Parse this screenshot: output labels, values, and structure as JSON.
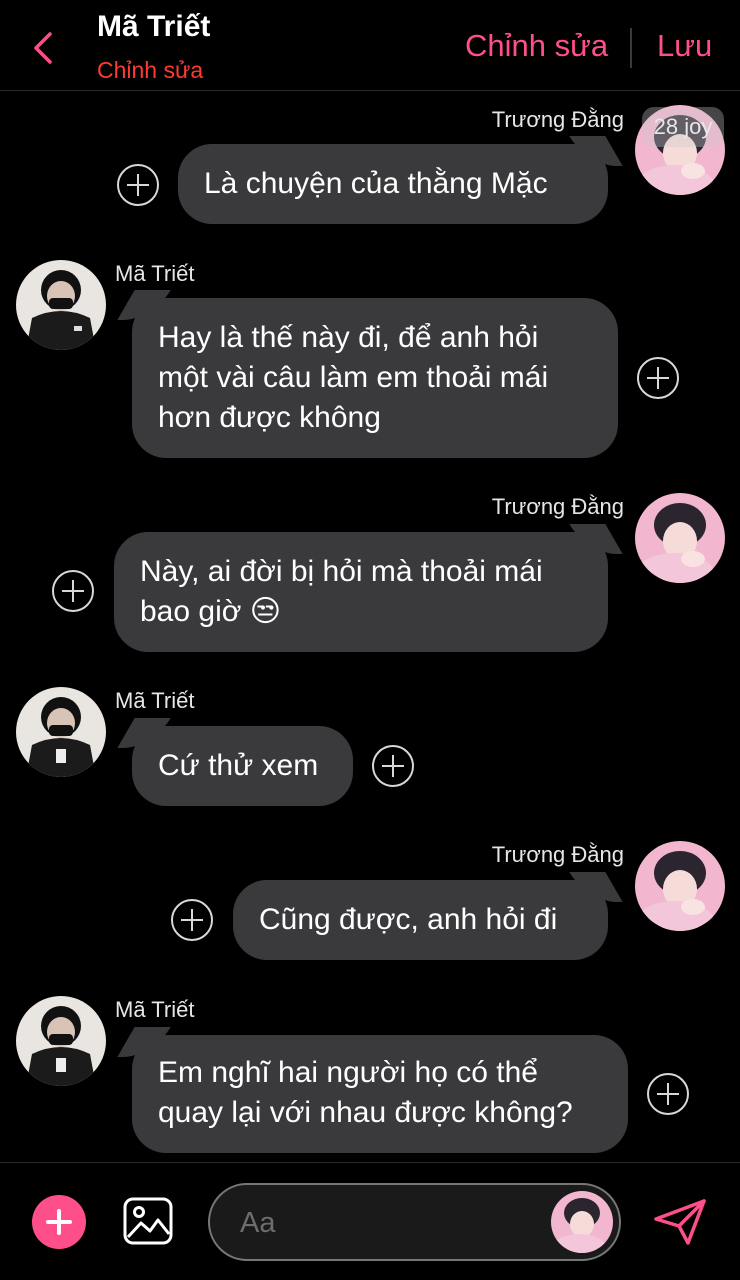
{
  "header": {
    "title": "Mã Triết",
    "subtitle": "Chỉnh sửa",
    "edit_label": "Chỉnh sửa",
    "save_label": "Lưu",
    "accent_color": "#ff4f8b"
  },
  "badge": "28 joy",
  "messages": [
    {
      "sender": "Trương Đằng",
      "side": "right",
      "text": "Là chuyện của thằng Mặc"
    },
    {
      "sender": "Mã Triết",
      "side": "left",
      "text": "Hay là thế này đi, để anh hỏi\nmột vài câu làm em thoải mái\nhơn được không"
    },
    {
      "sender": "Trương Đằng",
      "side": "right",
      "text": "Này, ai đời bị hỏi mà thoải mái\nbao giờ 😒"
    },
    {
      "sender": "Mã Triết",
      "side": "left",
      "text": "Cứ thử xem"
    },
    {
      "sender": "Trương Đằng",
      "side": "right",
      "text": "Cũng được, anh hỏi đi"
    },
    {
      "sender": "Mã Triết",
      "side": "left",
      "text": "Em nghĩ hai người họ có thể\nquay lại với nhau được không?"
    }
  ],
  "composer": {
    "placeholder": "Aa"
  },
  "icons": {
    "back": "chevron-left-icon",
    "add": "plus-icon",
    "gallery": "image-icon",
    "send": "send-icon",
    "reaction": "plus-circle-icon"
  }
}
